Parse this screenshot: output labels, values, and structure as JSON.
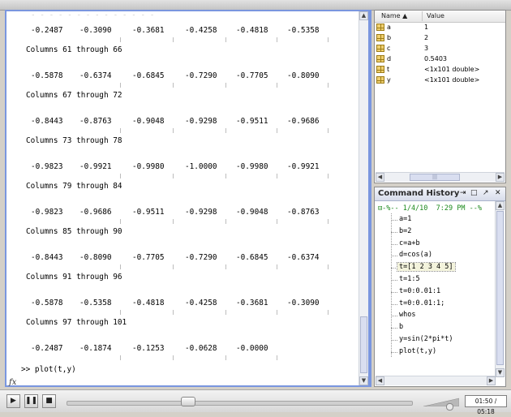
{
  "command_window": {
    "rows": [
      {
        "type": "values",
        "values": [
          "-0.2487",
          "-0.3090",
          "-0.3681",
          "-0.4258",
          "-0.4818",
          "-0.5358"
        ]
      },
      {
        "type": "header",
        "text": "Columns 61 through 66"
      },
      {
        "type": "values",
        "values": [
          "-0.5878",
          "-0.6374",
          "-0.6845",
          "-0.7290",
          "-0.7705",
          "-0.8090"
        ]
      },
      {
        "type": "header",
        "text": "Columns 67 through 72"
      },
      {
        "type": "values",
        "values": [
          "-0.8443",
          "-0.8763",
          "-0.9048",
          "-0.9298",
          "-0.9511",
          "-0.9686"
        ]
      },
      {
        "type": "header",
        "text": "Columns 73 through 78"
      },
      {
        "type": "values",
        "values": [
          "-0.9823",
          "-0.9921",
          "-0.9980",
          "-1.0000",
          "-0.9980",
          "-0.9921"
        ]
      },
      {
        "type": "header",
        "text": "Columns 79 through 84"
      },
      {
        "type": "values",
        "values": [
          "-0.9823",
          "-0.9686",
          "-0.9511",
          "-0.9298",
          "-0.9048",
          "-0.8763"
        ]
      },
      {
        "type": "header",
        "text": "Columns 85 through 90"
      },
      {
        "type": "values",
        "values": [
          "-0.8443",
          "-0.8090",
          "-0.7705",
          "-0.7290",
          "-0.6845",
          "-0.6374"
        ]
      },
      {
        "type": "header",
        "text": "Columns 91 through 96"
      },
      {
        "type": "values",
        "values": [
          "-0.5878",
          "-0.5358",
          "-0.4818",
          "-0.4258",
          "-0.3681",
          "-0.3090"
        ]
      },
      {
        "type": "header",
        "text": "Columns 97 through 101"
      },
      {
        "type": "values",
        "values": [
          "-0.2487",
          "-0.1874",
          "-0.1253",
          "-0.0628",
          "-0.0000"
        ]
      }
    ],
    "prompt_line": ">> plot(t,y)",
    "fx_label": "fx"
  },
  "workspace": {
    "col_name": "Name ▲",
    "col_value": "Value",
    "variables": [
      {
        "name": "a",
        "value": "1"
      },
      {
        "name": "b",
        "value": "2"
      },
      {
        "name": "c",
        "value": "3"
      },
      {
        "name": "d",
        "value": "0.5403"
      },
      {
        "name": "t",
        "value": "<1x101 double>"
      },
      {
        "name": "y",
        "value": "<1x101 double>"
      }
    ]
  },
  "history": {
    "title": "Command History",
    "session": "⊟-%-- 1/4/10  7:29 PM --%",
    "selected_index": 4,
    "commands": [
      "a=1",
      "b=2",
      "c=a+b",
      "d=cos(a)",
      "t=[1 2 3 4 5]",
      "t=1:5",
      "t=0:0.01:1",
      "t=0:0.01:1;",
      "whos",
      "b",
      "y=sin(2*pi*t)",
      "plot(t,y)"
    ]
  },
  "player": {
    "time": "01:50 / 05:18",
    "progress": 0.35
  },
  "colors": {
    "panel_border": "#7a96df",
    "history_session": "#1d8a1d"
  },
  "icons": [
    "variable-icon",
    "play-icon",
    "pause-icon",
    "stop-icon",
    "volume-icon",
    "fx-icon"
  ]
}
